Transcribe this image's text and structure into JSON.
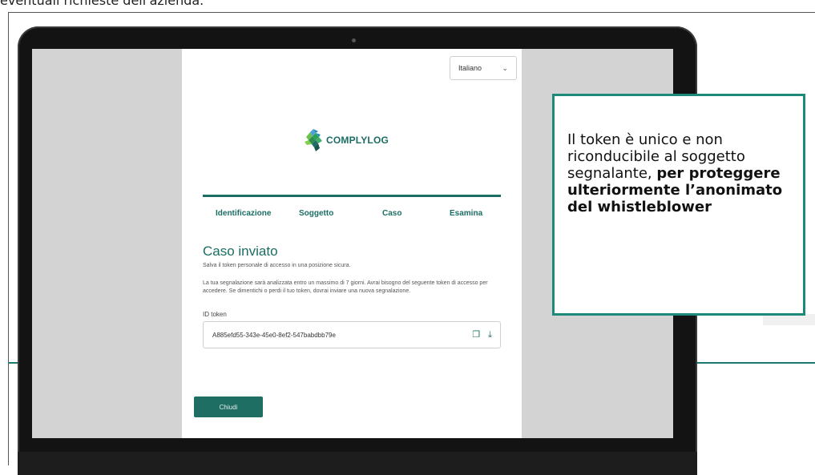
{
  "caption": "eventuali richieste dell'azienda.",
  "language_selector": {
    "value": "Italiano"
  },
  "brand": {
    "name": "COMPLYLOG"
  },
  "steps": [
    {
      "label": "Identificazione"
    },
    {
      "label": "Soggetto"
    },
    {
      "label": "Caso"
    },
    {
      "label": "Esamina"
    }
  ],
  "case": {
    "title": "Caso inviato",
    "subtitle": "Salva il token personale di accesso in una posizione sicura.",
    "info": "La tua segnalazione sarà analizzata entro un massimo di 7 giorni. Avrai bisogno del seguente token di accesso per accedere. Se dimentichi o perdi il tuo token, dovrai inviare una nuova segnalazione.",
    "token_label": "ID token",
    "token_value": "A885efd55-343e-45e0-8ef2-547babdbb79e",
    "close_label": "Chiudi"
  },
  "callout": {
    "text_normal": "Il token è unico e non riconducibile al soggetto segnalante, ",
    "text_bold": "per proteggere ulteriormente l’anonimato del whistleblower"
  },
  "colors": {
    "accent": "#1b6d63",
    "callout_border": "#1d8a79"
  }
}
